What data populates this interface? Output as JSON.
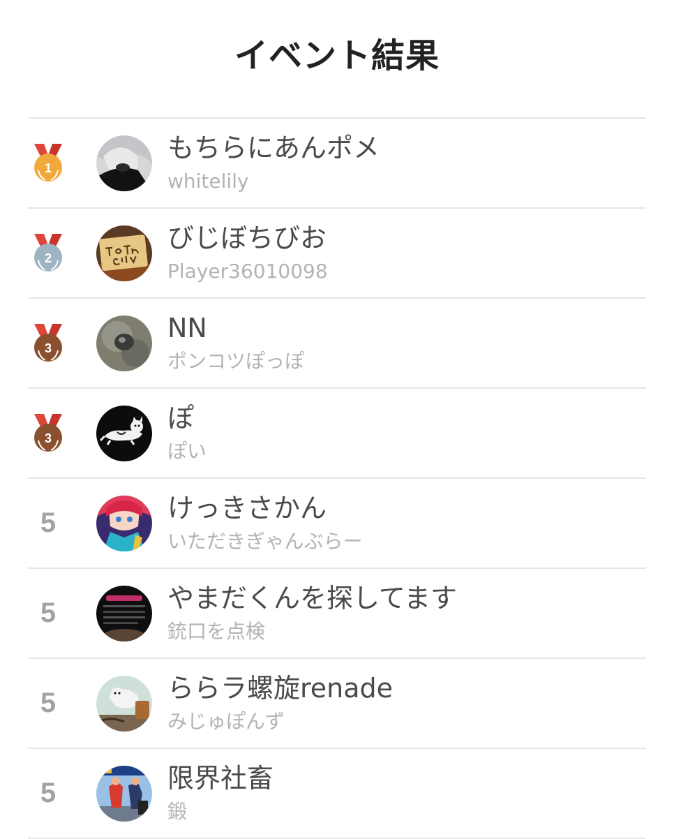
{
  "page": {
    "title": "イベント結果"
  },
  "colors": {
    "gold": "#f2a93b",
    "silver": "#9fb4c3",
    "bronze": "#8a5030",
    "ribbon": "#e0453a"
  },
  "results": [
    {
      "rank": "1",
      "medal": "gold",
      "name": "もちらにあんポメ",
      "sub": "whitelily",
      "avatar_icon": "grey-haired-person-avatar"
    },
    {
      "rank": "2",
      "medal": "silver",
      "name": "びじぼちびお",
      "sub": "Player36010098",
      "avatar_icon": "to-the-city-sign-avatar"
    },
    {
      "rank": "3",
      "medal": "bronze",
      "name": "NN",
      "sub": "ポンコツぽっぽ",
      "avatar_icon": "pigeon-closeup-avatar"
    },
    {
      "rank": "3",
      "medal": "bronze",
      "name": "ぽ",
      "sub": "ぽい",
      "avatar_icon": "lying-cat-drawing-avatar"
    },
    {
      "rank": "5",
      "medal": "",
      "name": "けっきさかん",
      "sub": "いただきぎゃんぶらー",
      "avatar_icon": "anime-character-avatar"
    },
    {
      "rank": "5",
      "medal": "",
      "name": "やまだくんを探してます",
      "sub": "銃口を点検",
      "avatar_icon": "dark-screenshot-avatar"
    },
    {
      "rank": "5",
      "medal": "",
      "name": "ららラ螺旋renade",
      "sub": "みじゅぽんず",
      "avatar_icon": "cartoon-animal-avatar"
    },
    {
      "rank": "5",
      "medal": "",
      "name": "限界社畜",
      "sub": "鍛",
      "avatar_icon": "fighting-game-avatar"
    }
  ]
}
